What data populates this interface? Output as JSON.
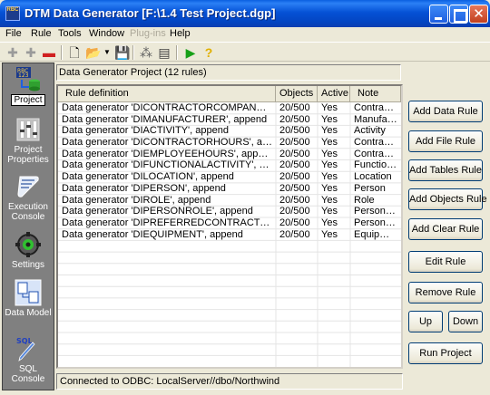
{
  "window": {
    "title": "DTM Data Generator [F:\\1.4 Test Project.dgp]",
    "app_icon_text": "RBC"
  },
  "menu": {
    "items": [
      "File",
      "Rule",
      "Tools",
      "Window",
      "Plug-ins",
      "Help"
    ]
  },
  "sidebar": {
    "items": [
      {
        "label": "Project",
        "icon": "project-icon"
      },
      {
        "label": "Project Properties",
        "icon": "properties-icon"
      },
      {
        "label": "Execution Console",
        "icon": "console-icon"
      },
      {
        "label": "Settings",
        "icon": "settings-icon"
      },
      {
        "label": "Data Model",
        "icon": "data-model-icon"
      },
      {
        "label": "SQL Console",
        "icon": "sql-icon"
      }
    ]
  },
  "project": {
    "header": "Data Generator Project (12 rules)"
  },
  "table": {
    "columns": [
      "Rule definition",
      "Objects",
      "Active",
      "Note"
    ],
    "rows": [
      {
        "rule": "Data generator 'DICONTRACTORCOMPANY', app...",
        "objects": "20/500",
        "active": "Yes",
        "note": "Contracto..."
      },
      {
        "rule": "Data generator 'DIMANUFACTURER', append",
        "objects": "20/500",
        "active": "Yes",
        "note": "Manufact..."
      },
      {
        "rule": "Data generator 'DIACTIVITY', append",
        "objects": "20/500",
        "active": "Yes",
        "note": "Activity"
      },
      {
        "rule": "Data generator 'DICONTRACTORHOURS', append",
        "objects": "20/500",
        "active": "Yes",
        "note": "Contracto..."
      },
      {
        "rule": "Data generator 'DIEMPLOYEEHOURS', append",
        "objects": "20/500",
        "active": "Yes",
        "note": "Contracto..."
      },
      {
        "rule": "Data generator 'DIFUNCTIONALACTIVITY', append",
        "objects": "20/500",
        "active": "Yes",
        "note": "Functiona..."
      },
      {
        "rule": "Data generator 'DILOCATION', append",
        "objects": "20/500",
        "active": "Yes",
        "note": "Location"
      },
      {
        "rule": "Data generator 'DIPERSON', append",
        "objects": "20/500",
        "active": "Yes",
        "note": "Person"
      },
      {
        "rule": "Data generator 'DIROLE', append",
        "objects": "20/500",
        "active": "Yes",
        "note": "Role"
      },
      {
        "rule": "Data generator 'DIPERSONROLE', append",
        "objects": "20/500",
        "active": "Yes",
        "note": "Person R..."
      },
      {
        "rule": "Data generator 'DIPREFERREDCONTRACTORCO...",
        "objects": "20/500",
        "active": "Yes",
        "note": "Person R..."
      },
      {
        "rule": "Data generator 'DIEQUIPMENT', append",
        "objects": "20/500",
        "active": "Yes",
        "note": "Equipment"
      }
    ]
  },
  "status": {
    "text": "Connected to  ODBC: LocalServer//dbo/Northwind"
  },
  "buttons": {
    "add_data_rule": "Add Data Rule",
    "add_file_rule": "Add File Rule",
    "add_tables_rule": "Add Tables Rule",
    "add_objects_rule": "Add Objects Rule",
    "add_clear_rule": "Add Clear Rule",
    "edit_rule": "Edit Rule",
    "remove_rule": "Remove Rule",
    "up": "Up",
    "down": "Down",
    "run_project": "Run Project"
  }
}
